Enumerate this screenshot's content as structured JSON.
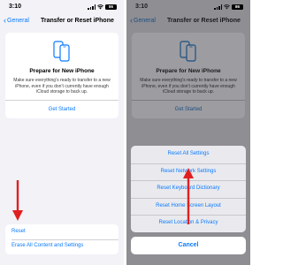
{
  "status_bar": {
    "time": "3:10",
    "battery": "86"
  },
  "nav": {
    "back_label": "General",
    "title": "Transfer or Reset iPhone"
  },
  "prepare_card": {
    "title": "Prepare for New iPhone",
    "description": "Make sure everything’s ready to transfer to a new iPhone, even if you don’t currently have enough iCloud storage to back up.",
    "action": "Get Started"
  },
  "bottom_options": {
    "reset": "Reset",
    "erase": "Erase All Content and Settings"
  },
  "reset_sheet": {
    "items": [
      "Reset All Settings",
      "Reset Network Settings",
      "Reset Keyboard Dictionary",
      "Reset Home Screen Layout",
      "Reset Location & Privacy"
    ],
    "cancel": "Cancel"
  },
  "colors": {
    "accent": "#0a7aff",
    "annotation_arrow": "#e02020"
  },
  "icons": {
    "back": "chevron-left-icon",
    "prepare": "phone-transfer-icon",
    "annotation": "red-arrow"
  }
}
